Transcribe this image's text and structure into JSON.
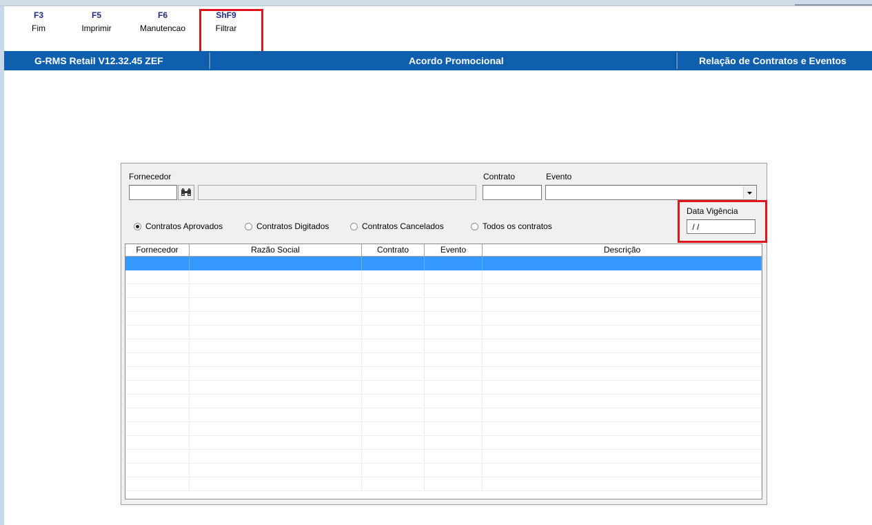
{
  "toolbar": {
    "buttons": [
      {
        "key": "F3",
        "label": "Fim"
      },
      {
        "key": "F5",
        "label": "Imprimir"
      },
      {
        "key": "F6",
        "label": "Manutencao"
      },
      {
        "key": "ShF9",
        "label": "Filtrar"
      }
    ]
  },
  "header": {
    "app_version": "G-RMS Retail V12.32.45 ZEF",
    "module": "Acordo Promocional",
    "screen": "Relação de Contratos e Eventos"
  },
  "form": {
    "fornecedor_label": "Fornecedor",
    "fornecedor_code": "",
    "fornecedor_name": "",
    "contrato_label": "Contrato",
    "contrato_value": "",
    "evento_label": "Evento",
    "evento_value": "",
    "data_vigencia_label": "Data Vigência",
    "data_vigencia_value": " / /",
    "filter_options": [
      {
        "label": "Contratos Aprovados",
        "selected": true
      },
      {
        "label": "Contratos Digitados",
        "selected": false
      },
      {
        "label": "Contratos Cancelados",
        "selected": false
      },
      {
        "label": "Todos os contratos",
        "selected": false
      }
    ]
  },
  "grid": {
    "columns": [
      "Fornecedor",
      "Razão Social",
      "Contrato",
      "Evento",
      "Descrição"
    ],
    "selected_row": 0
  },
  "icons": {
    "search": "binoculars-icon",
    "dropdown": "chevron-down-icon"
  },
  "colors": {
    "header_blue": "#0e5fae",
    "toolbar_key": "#1c2a87",
    "selection": "#3399ff",
    "highlight_red": "#e0141c"
  }
}
